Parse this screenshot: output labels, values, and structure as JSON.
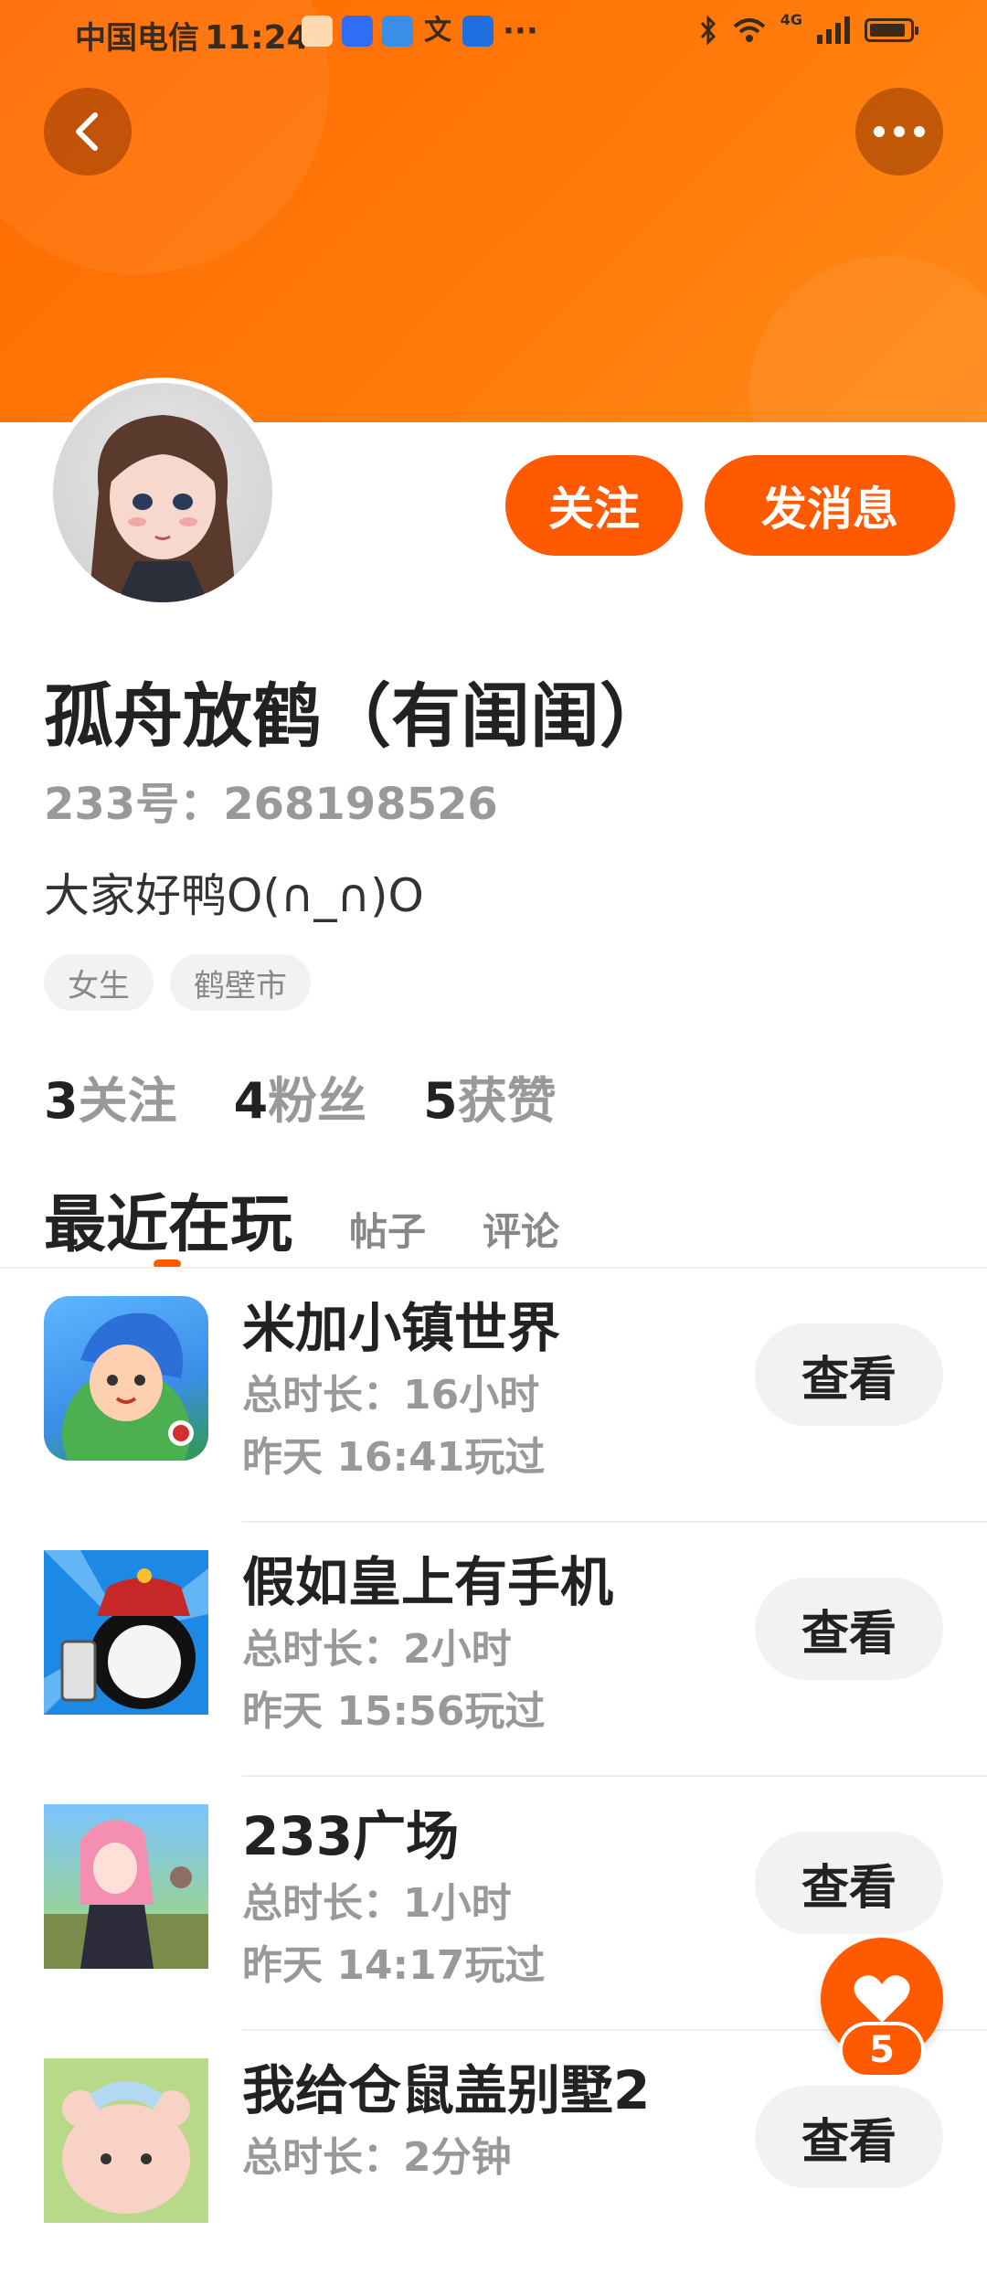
{
  "status_bar": {
    "carrier": "中国电信",
    "time": "11:24",
    "more": "···",
    "network": "4G"
  },
  "profile": {
    "follow_label": "关注",
    "message_label": "发消息",
    "name": "孤舟放鹤（有闺闺）",
    "id_text": "233号：268198526",
    "bio": "大家好鸭O(∩_∩)O",
    "tags": [
      "女生",
      "鹤壁市"
    ],
    "stats": [
      {
        "num": "3",
        "label": "关注"
      },
      {
        "num": "4",
        "label": "粉丝"
      },
      {
        "num": "5",
        "label": "获赞"
      }
    ]
  },
  "tabs": [
    "最近在玩",
    "帖子",
    "评论"
  ],
  "games": [
    {
      "title": "米加小镇世界",
      "duration": "总时长：16小时",
      "last_played": "昨天 16:41玩过",
      "action": "查看",
      "icon": "miga-town-icon"
    },
    {
      "title": "假如皇上有手机",
      "duration": "总时长：2小时",
      "last_played": "昨天 15:56玩过",
      "action": "查看",
      "icon": "emperor-phone-icon"
    },
    {
      "title": "233广场",
      "duration": "总时长：1小时",
      "last_played": "昨天 14:17玩过",
      "action": "查看",
      "icon": "plaza-233-icon"
    },
    {
      "title": "我给仓鼠盖别墅2",
      "duration": "总时长：2分钟",
      "last_played": "",
      "action": "查看",
      "icon": "hamster-villa-icon"
    }
  ],
  "like_fab": {
    "count": "5",
    "icon": "heart-icon"
  },
  "colors": {
    "accent": "#ff5a00",
    "header": "#ff7a0a",
    "muted": "#999999"
  }
}
